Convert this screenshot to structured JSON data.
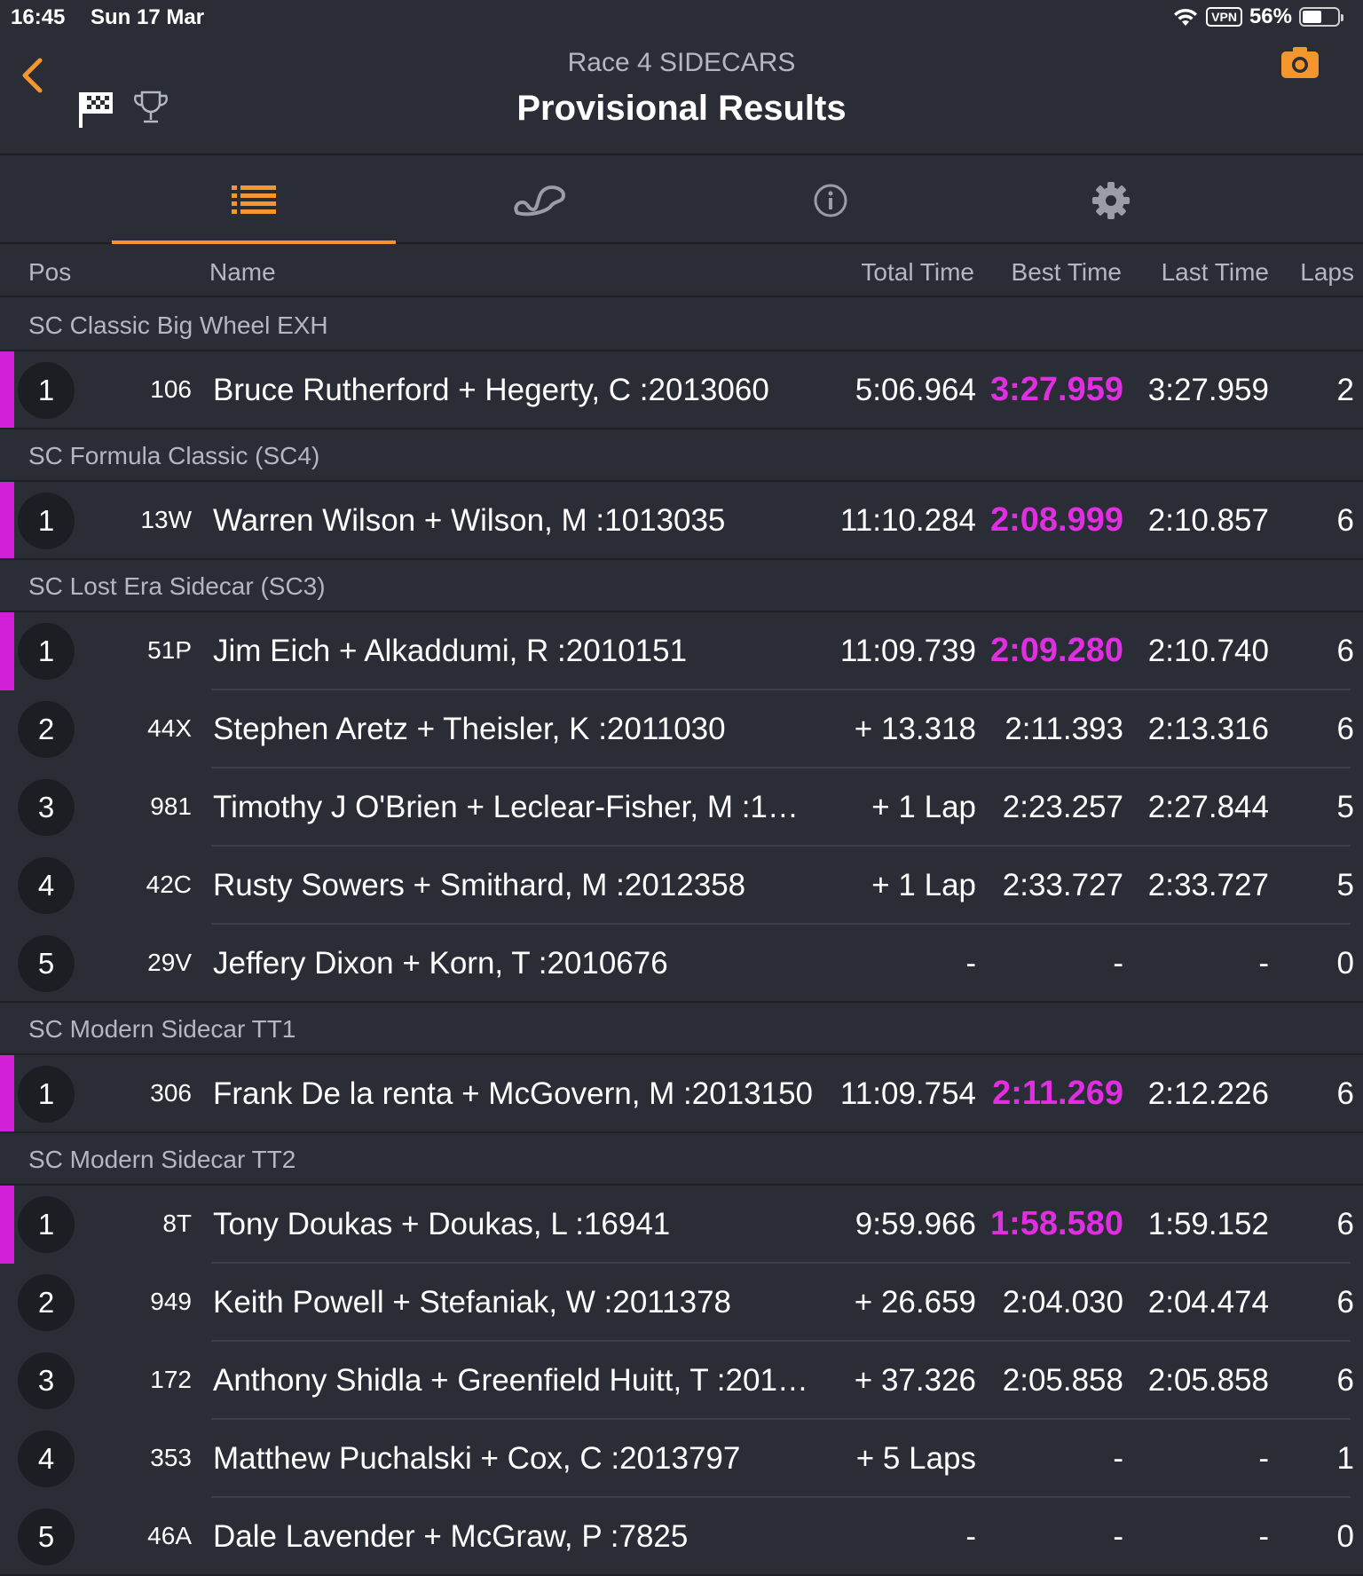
{
  "status_bar": {
    "time": "16:45",
    "date": "Sun 17 Mar",
    "vpn": "VPN",
    "battery": "56%"
  },
  "header": {
    "subtitle": "Race 4 SIDECARS",
    "title": "Provisional Results"
  },
  "icons": {
    "back": "chevron-left-icon",
    "flag": "checkered-flag-icon",
    "trophy": "trophy-icon",
    "camera": "camera-icon"
  },
  "colors": {
    "accent": "#f4952d",
    "best_highlight": "#e12ee2",
    "background": "#2a2d36"
  },
  "tabs": [
    {
      "icon": "list-icon",
      "active": true
    },
    {
      "icon": "track-icon",
      "active": false
    },
    {
      "icon": "info-icon",
      "active": false
    },
    {
      "icon": "gear-icon",
      "active": false
    }
  ],
  "columns": {
    "pos": "Pos",
    "name": "Name",
    "total": "Total Time",
    "best": "Best Time",
    "last": "Last Time",
    "laps": "Laps"
  },
  "groups": [
    {
      "title": "SC Classic Big Wheel EXH",
      "rows": [
        {
          "pos": "1",
          "num": "106",
          "name": "Bruce Rutherford + Hegerty, C :2013060",
          "total": "5:06.964",
          "best": "3:27.959",
          "last": "3:27.959",
          "laps": "2",
          "leader": true
        }
      ]
    },
    {
      "title": "SC Formula Classic (SC4)",
      "rows": [
        {
          "pos": "1",
          "num": "13W",
          "name": "Warren Wilson + Wilson, M :1013035",
          "total": "11:10.284",
          "best": "2:08.999",
          "last": "2:10.857",
          "laps": "6",
          "leader": true
        }
      ]
    },
    {
      "title": "SC Lost Era Sidecar (SC3)",
      "rows": [
        {
          "pos": "1",
          "num": "51P",
          "name": "Jim Eich + Alkaddumi, R :2010151",
          "total": "11:09.739",
          "best": "2:09.280",
          "last": "2:10.740",
          "laps": "6",
          "leader": true
        },
        {
          "pos": "2",
          "num": "44X",
          "name": "Stephen Aretz + Theisler, K :2011030",
          "total": "+ 13.318",
          "best": "2:11.393",
          "last": "2:13.316",
          "laps": "6",
          "leader": false
        },
        {
          "pos": "3",
          "num": "981",
          "name": "Timothy J O'Brien + Leclear-Fisher, M :1…",
          "total": "+ 1 Lap",
          "best": "2:23.257",
          "last": "2:27.844",
          "laps": "5",
          "leader": false
        },
        {
          "pos": "4",
          "num": "42C",
          "name": "Rusty Sowers + Smithard, M :2012358",
          "total": "+ 1 Lap",
          "best": "2:33.727",
          "last": "2:33.727",
          "laps": "5",
          "leader": false
        },
        {
          "pos": "5",
          "num": "29V",
          "name": "Jeffery Dixon + Korn, T :2010676",
          "total": "-",
          "best": "-",
          "last": "-",
          "laps": "0",
          "leader": false
        }
      ]
    },
    {
      "title": "SC Modern Sidecar TT1",
      "rows": [
        {
          "pos": "1",
          "num": "306",
          "name": "Frank De la renta + McGovern, M :2013150",
          "total": "11:09.754",
          "best": "2:11.269",
          "last": "2:12.226",
          "laps": "6",
          "leader": true
        }
      ]
    },
    {
      "title": "SC Modern Sidecar TT2",
      "rows": [
        {
          "pos": "1",
          "num": "8T",
          "name": "Tony Doukas + Doukas, L :16941",
          "total": "9:59.966",
          "best": "1:58.580",
          "last": "1:59.152",
          "laps": "6",
          "leader": true
        },
        {
          "pos": "2",
          "num": "949",
          "name": "Keith Powell + Stefaniak, W :2011378",
          "total": "+ 26.659",
          "best": "2:04.030",
          "last": "2:04.474",
          "laps": "6",
          "leader": false
        },
        {
          "pos": "3",
          "num": "172",
          "name": "Anthony Shidla + Greenfield Huitt, T :201…",
          "total": "+ 37.326",
          "best": "2:05.858",
          "last": "2:05.858",
          "laps": "6",
          "leader": false
        },
        {
          "pos": "4",
          "num": "353",
          "name": "Matthew Puchalski + Cox, C :2013797",
          "total": "+ 5 Laps",
          "best": "-",
          "last": "-",
          "laps": "1",
          "leader": false
        },
        {
          "pos": "5",
          "num": "46A",
          "name": "Dale Lavender + McGraw, P :7825",
          "total": "-",
          "best": "-",
          "last": "-",
          "laps": "0",
          "leader": false
        }
      ]
    }
  ]
}
